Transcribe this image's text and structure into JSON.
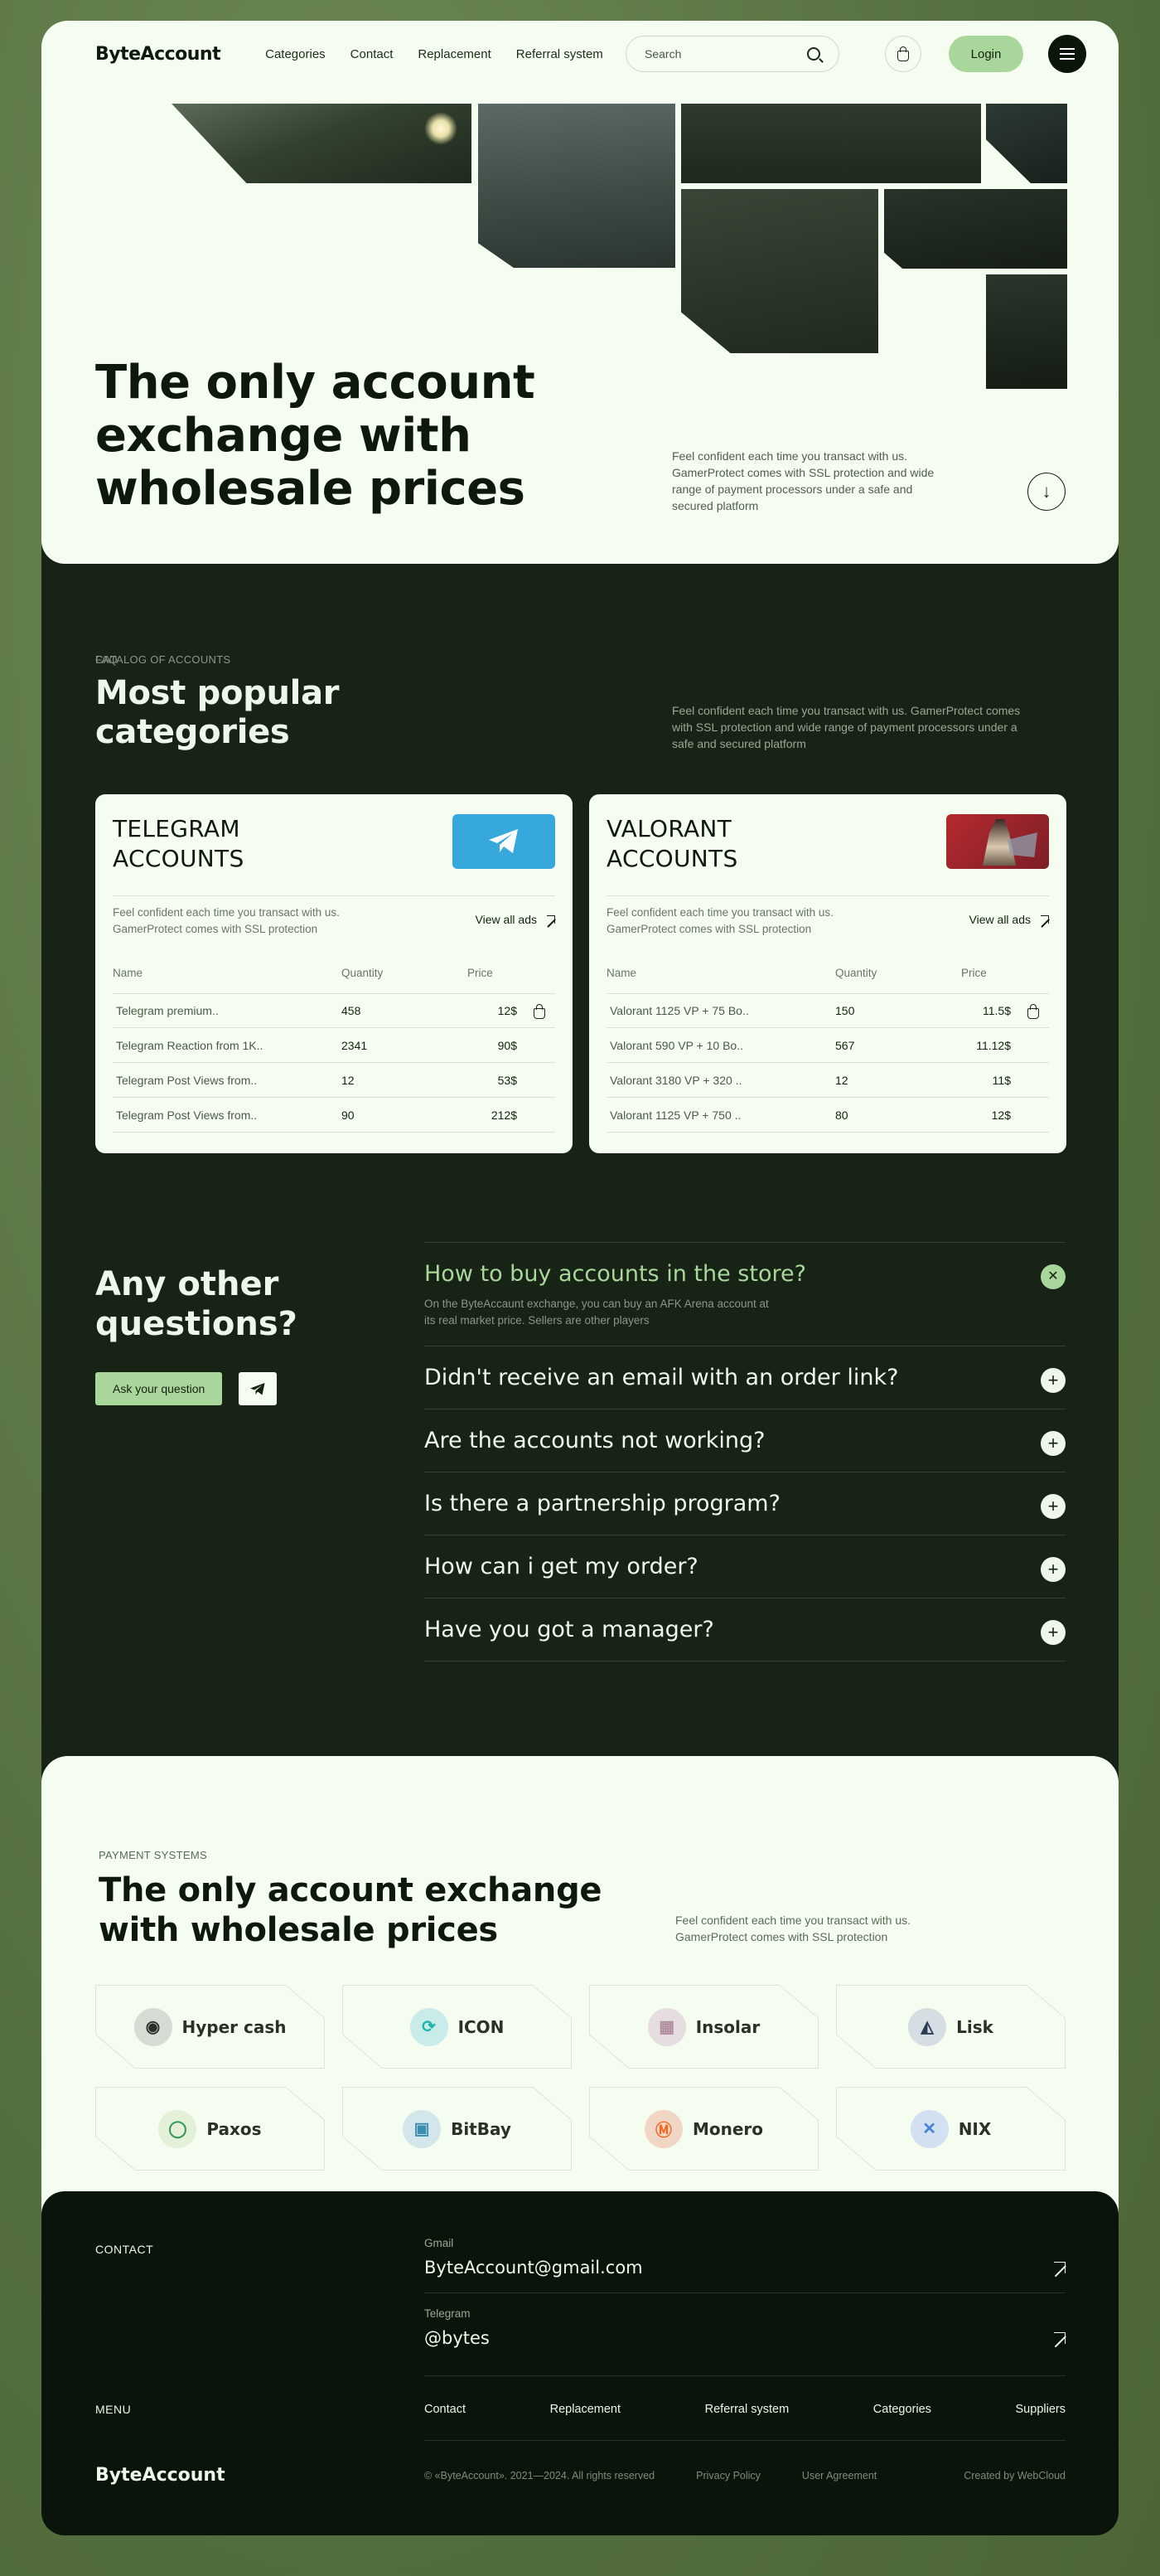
{
  "nav": {
    "logo": "ByteAccount",
    "links": [
      "Categories",
      "Contact",
      "Replacement",
      "Referral system"
    ],
    "search_placeholder": "Search",
    "login": "Login"
  },
  "hero": {
    "title": "The only account exchange with wholesale prices",
    "desc": "Feel confident each time you transact with us. GamerProtect comes with SSL protection and wide range of payment processors under a safe and secured platform"
  },
  "catalog": {
    "kicker": "CATALOG OF ACCOUNTS",
    "title": "Most popular categories",
    "desc": "Feel confident each time you transact with us. GamerProtect comes with SSL protection and wide range of payment processors under a safe and secured platform",
    "cards": [
      {
        "title": "TELEGRAM ACCOUNTS",
        "desc": "Feel confident each time you transact with us. GamerProtect comes with SSL protection",
        "view_all": "View all ads",
        "headers": [
          "Name",
          "Quantity",
          "Price"
        ],
        "rows": [
          {
            "name": "Telegram premium..",
            "qty": "458",
            "price": "12$"
          },
          {
            "name": "Telegram Reaction from 1K..",
            "qty": "2341",
            "price": "90$"
          },
          {
            "name": "Telegram Post Views from..",
            "qty": "12",
            "price": "53$"
          },
          {
            "name": "Telegram Post Views from..",
            "qty": "90",
            "price": "212$"
          }
        ]
      },
      {
        "title": "VALORANT ACCOUNTS",
        "desc": "Feel confident each time you transact with us. GamerProtect comes with SSL protection",
        "view_all": "View all ads",
        "headers": [
          "Name",
          "Quantity",
          "Price"
        ],
        "rows": [
          {
            "name": "Valorant 1125 VP + 75 Bo..",
            "qty": "150",
            "price": "11.5$"
          },
          {
            "name": "Valorant 590 VP + 10 Bo..",
            "qty": "567",
            "price": "11.12$"
          },
          {
            "name": "Valorant 3180 VP + 320 ..",
            "qty": "12",
            "price": "11$"
          },
          {
            "name": "Valorant 1125 VP + 750 ..",
            "qty": "80",
            "price": "12$"
          }
        ]
      }
    ]
  },
  "faq": {
    "kicker": "FAQ",
    "title": "Any other questions?",
    "ask": "Ask your question",
    "items": [
      {
        "q": "How to buy accounts in the store?",
        "a": "On the ByteAccaunt exchange, you can buy an AFK Arena account at its real market price. Sellers are other players"
      },
      {
        "q": "Didn't receive an email with an order link?"
      },
      {
        "q": "Are the accounts not working?"
      },
      {
        "q": "Is there a partnership program?"
      },
      {
        "q": "How can i get my order?"
      },
      {
        "q": "Have you got a manager?"
      }
    ]
  },
  "payment": {
    "kicker": "PAYMENT SYSTEMS",
    "title": "The only account exchange with wholesale prices",
    "desc": "Feel confident each time you transact with us. GamerProtect comes with SSL protection",
    "coins": [
      {
        "name": "Hyper cash",
        "icon": "hypercash-icon",
        "bg": "#d5dcd3",
        "fg": "#2a3128",
        "glyph": "◉"
      },
      {
        "name": "ICON",
        "icon": "icon-coin-icon",
        "bg": "#c9ecea",
        "fg": "#1fb5a9",
        "glyph": "⟳"
      },
      {
        "name": "Insolar",
        "icon": "insolar-icon",
        "bg": "#e6dde0",
        "fg": "#b38ea0",
        "glyph": "▦"
      },
      {
        "name": "Lisk",
        "icon": "lisk-icon",
        "bg": "#d6dde3",
        "fg": "#2b3d55",
        "glyph": "◭"
      },
      {
        "name": "Paxos",
        "icon": "paxos-icon",
        "bg": "#e4f0d7",
        "fg": "#2f9a57",
        "glyph": "◯"
      },
      {
        "name": "BitBay",
        "icon": "bitbay-icon",
        "bg": "#d3e6ec",
        "fg": "#3a8fb0",
        "glyph": "▣"
      },
      {
        "name": "Monero",
        "icon": "monero-icon",
        "bg": "#f1d6c6",
        "fg": "#f26822",
        "glyph": "Ⓜ"
      },
      {
        "name": "NIX",
        "icon": "nix-icon",
        "bg": "#d3e0f2",
        "fg": "#4a80d8",
        "glyph": "✕"
      }
    ]
  },
  "footer": {
    "contact_label": "CONTACT",
    "gmail_label": "Gmail",
    "gmail": "ByteAccount@gmail.com",
    "telegram_label": "Telegram",
    "telegram": "@bytes",
    "menu_label": "MENU",
    "menu": [
      "Contact",
      "Replacement",
      "Referral system",
      "Categories",
      "Suppliers"
    ],
    "logo": "ByteAccount",
    "copyright": "© «ByteAccount». 2021—2024. All rights reserved",
    "privacy": "Privacy Policy",
    "agreement": "User Agreement",
    "created": "Created by WebCloud"
  }
}
